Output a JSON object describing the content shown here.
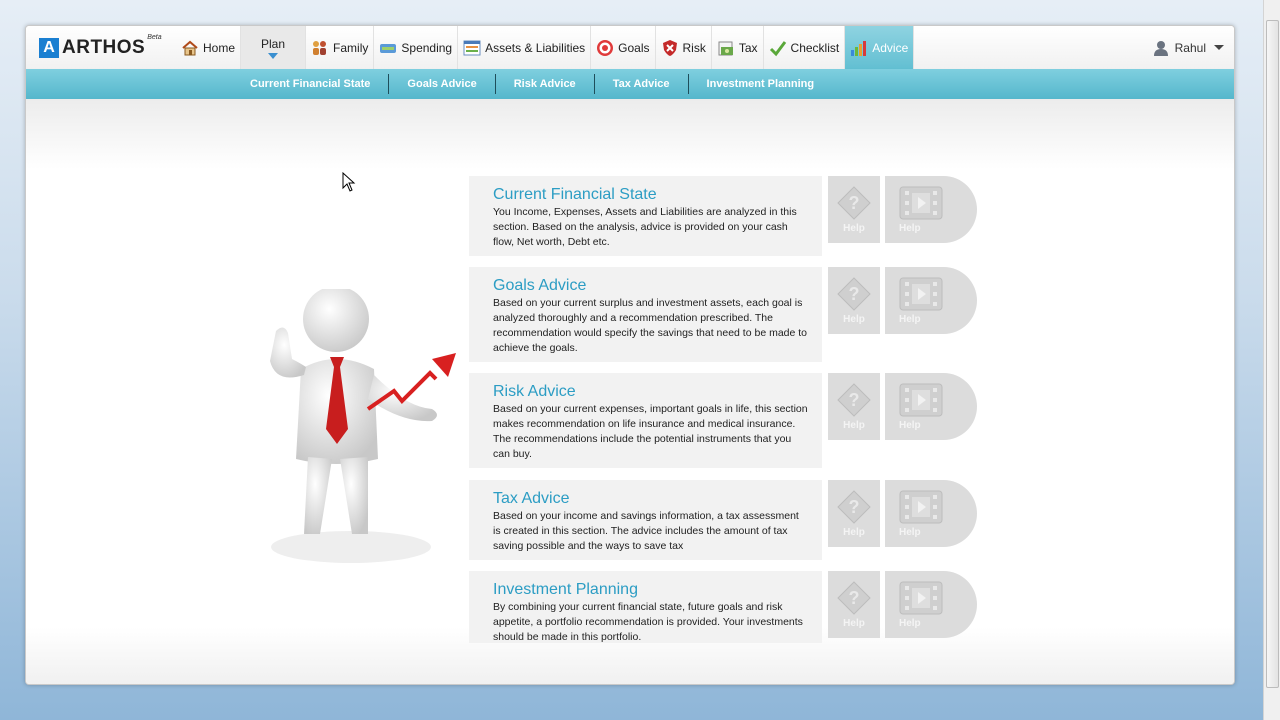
{
  "brand": {
    "name": "ARTHOS",
    "mark": "A",
    "tag": "Beta"
  },
  "nav": {
    "items": [
      {
        "label": "Home",
        "icon": "home-icon"
      },
      {
        "label": "Plan",
        "icon": ""
      },
      {
        "label": "Family",
        "icon": "family-icon"
      },
      {
        "label": "Spending",
        "icon": "spending-icon"
      },
      {
        "label": "Assets & Liabilities",
        "icon": "assets-icon"
      },
      {
        "label": "Goals",
        "icon": "target-icon"
      },
      {
        "label": "Risk",
        "icon": "shield-icon"
      },
      {
        "label": "Tax",
        "icon": "tax-icon"
      },
      {
        "label": "Checklist",
        "icon": "check-icon"
      },
      {
        "label": "Advice",
        "icon": "chart-icon"
      }
    ],
    "active": "Advice"
  },
  "user": {
    "name": "Rahul"
  },
  "subnav": {
    "items": [
      "Current Financial State",
      "Goals Advice",
      "Risk Advice",
      "Tax Advice",
      "Investment Planning"
    ]
  },
  "cards": [
    {
      "title": "Current Financial State",
      "desc": "You Income, Expenses, Assets and Liabilities are analyzed in this section. Based on the analysis, advice is provided on your cash flow, Net worth, Debt etc.",
      "help_q": "Help",
      "help_v": "Help"
    },
    {
      "title": "Goals Advice",
      "desc": "Based on your current surplus and investment assets, each goal is analyzed thoroughly and a recommendation prescribed. The recommendation would specify the savings that need to be made to achieve the goals.",
      "help_q": "Help",
      "help_v": "Help"
    },
    {
      "title": "Risk Advice",
      "desc": "Based on your current expenses, important goals in life, this section makes recommendation on life insurance and medical insurance. The recommendations include the potential instruments that you can buy.",
      "help_q": "Help",
      "help_v": "Help"
    },
    {
      "title": "Tax Advice",
      "desc": "Based on your income and savings information, a tax assessment is created in this section. The advice includes the amount of tax saving possible and the ways to save tax",
      "help_q": "Help",
      "help_v": "Help"
    },
    {
      "title": "Investment Planning",
      "desc": "By combining your current financial state, future goals and risk appetite, a portfolio recommendation is provided. Your investments should be made in this portfolio.",
      "help_q": "Help",
      "help_v": "Help"
    }
  ],
  "colors": {
    "accent": "#55b7cc",
    "title": "#2c9dc4",
    "brand": "#1a7fd1"
  }
}
